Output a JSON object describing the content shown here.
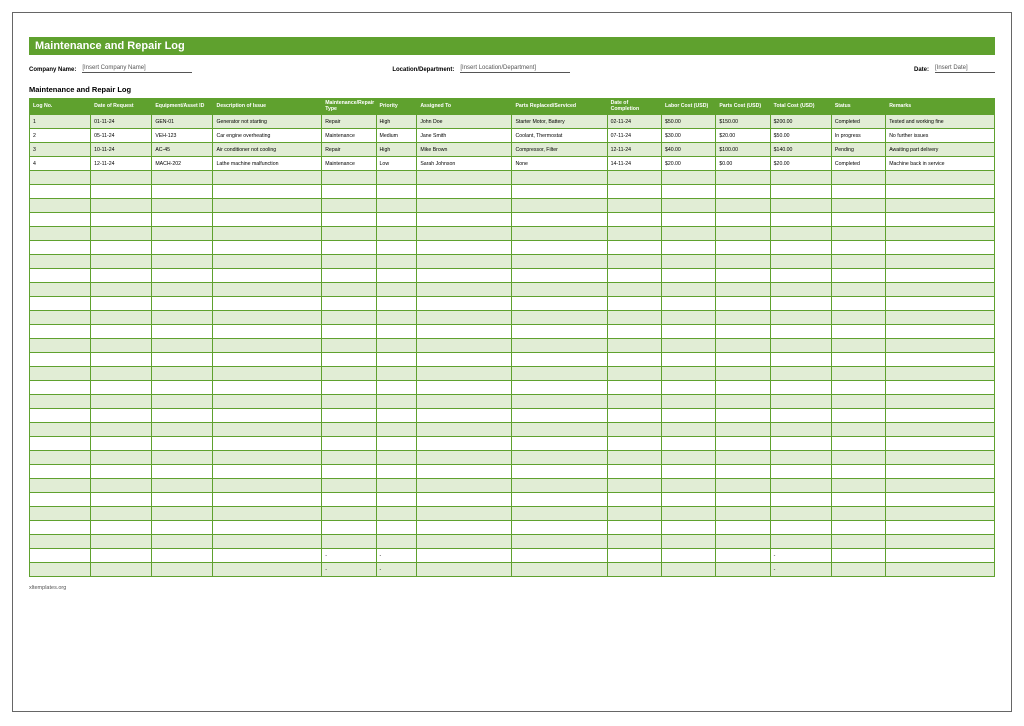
{
  "title": "Maintenance and Repair Log",
  "meta": {
    "company_label": "Company Name:",
    "company_value": "[Insert Company Name]",
    "location_label": "Location/Department:",
    "location_value": "[Insert Location/Department]",
    "date_label": "Date:",
    "date_value": "[Insert Date]"
  },
  "section_title": "Maintenance and Repair Log",
  "headers": {
    "log_no": "Log No.",
    "date_req": "Date of Request",
    "equip": "Equipment/Asset ID",
    "desc": "Description of Issue",
    "type": "Maintenance/Repair Type",
    "priority": "Priority",
    "assigned": "Assigned To",
    "parts": "Parts Replaced/Serviced",
    "date_compl": "Date of Completion",
    "labor": "Labor Cost (USD)",
    "parts_cost": "Parts Cost (USD)",
    "total": "Total Cost (USD)",
    "status": "Status",
    "remarks": "Remarks"
  },
  "rows": [
    {
      "log_no": "1",
      "date_req": "01-11-24",
      "equip": "GEN-01",
      "desc": "Generator not starting",
      "type": "Repair",
      "priority": "High",
      "assigned": "John Doe",
      "parts": "Starter Motor, Battery",
      "date_compl": "02-11-24",
      "labor": "$50.00",
      "parts_cost": "$150.00",
      "total": "$200.00",
      "status": "Completed",
      "remarks": "Tested and working fine"
    },
    {
      "log_no": "2",
      "date_req": "05-11-24",
      "equip": "VEH-123",
      "desc": "Car engine overheating",
      "type": "Maintenance",
      "priority": "Medium",
      "assigned": "Jane Smith",
      "parts": "Coolant, Thermostat",
      "date_compl": "07-11-24",
      "labor": "$30.00",
      "parts_cost": "$20.00",
      "total": "$50.00",
      "status": "In progress",
      "remarks": "No further issues"
    },
    {
      "log_no": "3",
      "date_req": "10-11-24",
      "equip": "AC-45",
      "desc": "Air conditioner not cooling",
      "type": "Repair",
      "priority": "High",
      "assigned": "Mike Brown",
      "parts": "Compressor, Filter",
      "date_compl": "12-11-24",
      "labor": "$40.00",
      "parts_cost": "$100.00",
      "total": "$140.00",
      "status": "Pending",
      "remarks": "Awaiting part delivery"
    },
    {
      "log_no": "4",
      "date_req": "12-11-24",
      "equip": "MACH-202",
      "desc": "Lathe machine malfunction",
      "type": "Maintenance",
      "priority": "Low",
      "assigned": "Sarah Johnson",
      "parts": "None",
      "date_compl": "14-11-24",
      "labor": "$20.00",
      "parts_cost": "$0.00",
      "total": "$20.00",
      "status": "Completed",
      "remarks": "Machine back in service"
    }
  ],
  "summary_row": {
    "type": "-",
    "priority": "-",
    "total": "-"
  },
  "footer": "xltemplates.org",
  "empty_rows_before_summary": 27
}
